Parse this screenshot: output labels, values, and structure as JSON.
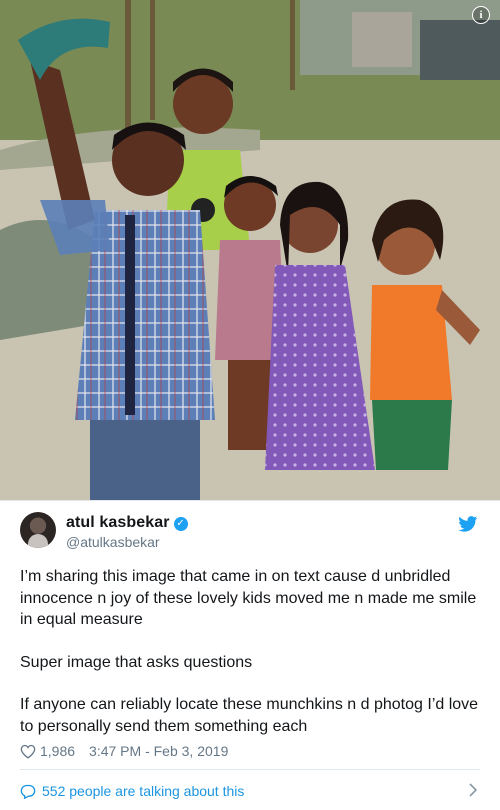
{
  "tweet": {
    "display_name": "atul kasbekar",
    "handle": "@atulkasbekar",
    "paragraphs": [
      "I’m sharing this image that came in on text cause d unbridled innocence n joy of these lovely kids moved me n made me smile in equal measure",
      "Super image that asks questions",
      "If anyone can reliably locate these munchkins n d photog I’d love to personally send them something each"
    ],
    "likes": "1,986",
    "timestamp": "3:47 PM - Feb 3, 2019",
    "conversation_link": "552 people are talking about this"
  },
  "icons": {
    "info": "info-icon",
    "verified": "verified-badge-icon",
    "twitter_logo": "twitter-bird-icon",
    "like": "heart-icon",
    "conversation": "speech-bubble-icon",
    "chevron": "chevron-right-icon"
  },
  "colors": {
    "twitter_blue": "#1da1f2",
    "link_blue": "#1b95e0",
    "secondary_text": "#657786",
    "divider": "#e1e8ed"
  }
}
